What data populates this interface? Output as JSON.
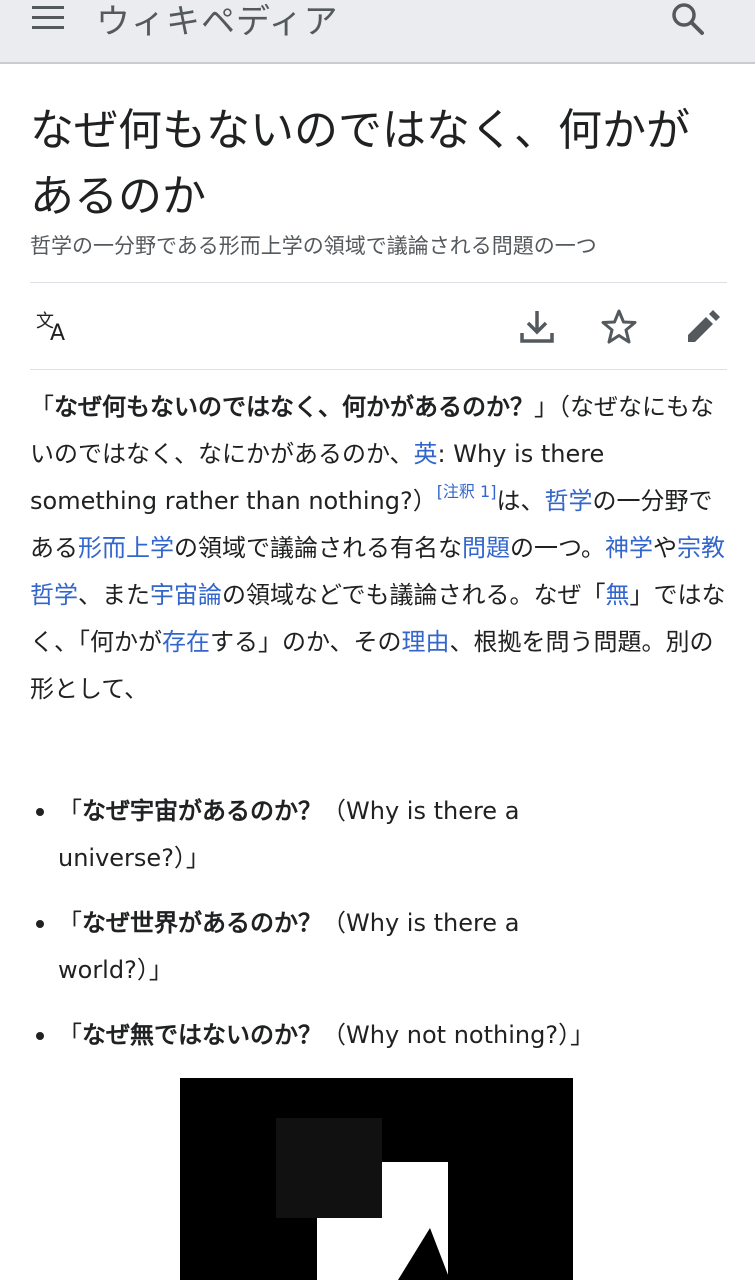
{
  "header": {
    "wordmark": "ウィキペディア",
    "menu_icon": "hamburger-menu-icon",
    "search_icon": "search-icon"
  },
  "article": {
    "title": "なぜ何もないのではなく、何かがあるのか",
    "tagline": "哲学の一分野である形而上学の領域で議論される問題の一つ"
  },
  "actions": {
    "language_icon": "language-icon",
    "download_icon": "download-icon",
    "watch_icon": "star-icon",
    "edit_icon": "edit-pencil-icon"
  },
  "lead": {
    "open_quote": "「",
    "bold_title": "なぜ何もないのではなく、何かがあるのか？",
    "close_quote": "」",
    "reading": "（なぜなにもないのではなく、なにかがあるのか、",
    "lang_link": "英",
    "english": ": Why is there something rather than nothing?）",
    "footnote": "[注釈 1]",
    "t1": "は、",
    "link_philosophy": "哲学",
    "t2": "の一分野である",
    "link_metaphysics": "形而上学",
    "t3": "の領域で議論される有名な",
    "link_problem": "問題",
    "t4": "の一つ。",
    "link_theology": "神学",
    "t5": "や",
    "link_philosophy_of_religion": "宗教哲学",
    "t6": "、また",
    "link_cosmology": "宇宙論",
    "t7": "の領域などでも議論される。なぜ「",
    "link_nothing": "無",
    "t8": "」ではなく、「何かが",
    "link_existence": "存在",
    "t9": "する」のか、その",
    "link_reason": "理由",
    "t10": "、根拠を問う問題。別の形として、"
  },
  "variants": [
    {
      "open": "「",
      "bold": "なぜ宇宙があるのか？",
      "rest": "（Why is there a universe?）」"
    },
    {
      "open": "「",
      "bold": "なぜ世界があるのか？",
      "rest": "（Why is there a world?）」"
    },
    {
      "open": "「",
      "bold": "なぜ無ではないのか？",
      "rest": "（Why not nothing?）」"
    }
  ],
  "figure": {
    "icon": "black-square-artwork-image"
  }
}
